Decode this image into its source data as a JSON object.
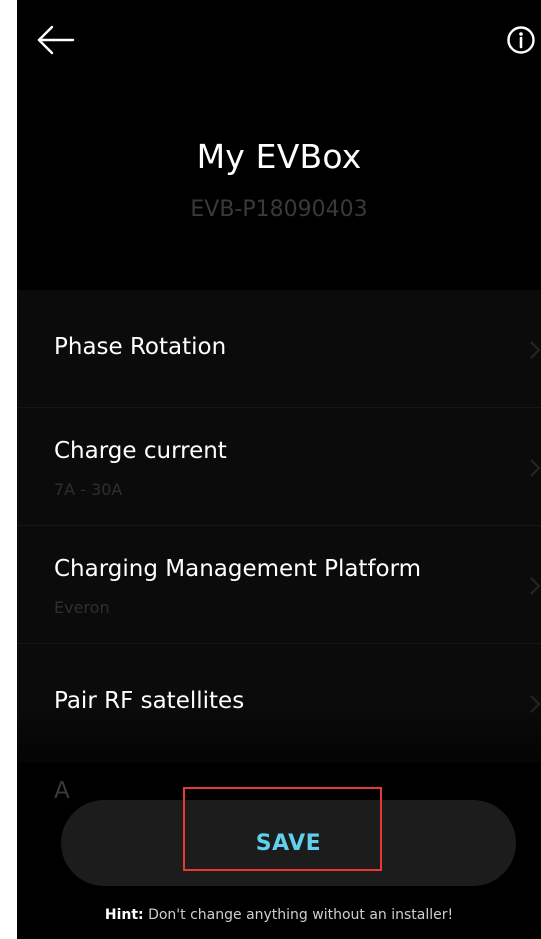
{
  "header": {
    "back_icon": "arrow-left-icon",
    "info_icon": "info-circle-icon"
  },
  "device": {
    "title": "My EVBox",
    "serial": "EVB-P18090403"
  },
  "settings": [
    {
      "label": "Phase Rotation",
      "value": ""
    },
    {
      "label": "Charge current",
      "value": "7A - 30A"
    },
    {
      "label": "Charging Management Platform",
      "value": "Everon"
    },
    {
      "label": "Pair RF satellites",
      "value": ""
    }
  ],
  "partial_row_label": "A",
  "save_label": "SAVE",
  "hint": {
    "prefix": "Hint:",
    "text": " Don't change anything without an installer!"
  },
  "colors": {
    "background": "#000000",
    "accent": "#5fd1ec",
    "highlight_box": "#e53935"
  }
}
